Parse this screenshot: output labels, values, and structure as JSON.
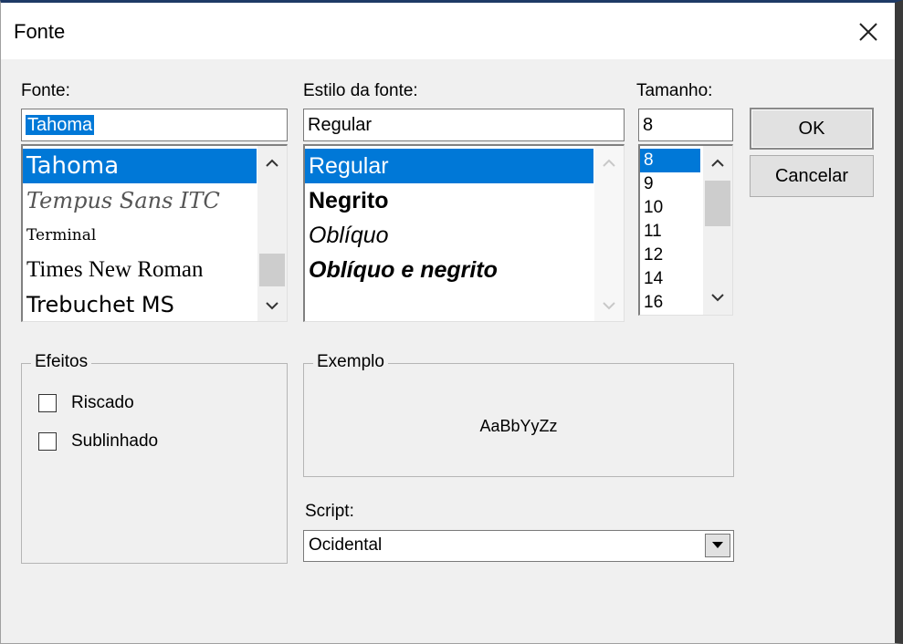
{
  "dialog": {
    "title": "Fonte",
    "close_icon": "close-icon"
  },
  "font": {
    "label": "Fonte:",
    "value": "Tahoma",
    "items": [
      "Tahoma",
      "Tempus Sans ITC",
      "Terminal",
      "Times New Roman",
      "Trebuchet MS"
    ],
    "selected": "Tahoma"
  },
  "style": {
    "label": "Estilo da fonte:",
    "value": "Regular",
    "items": [
      "Regular",
      "Negrito",
      "Oblíquo",
      "Oblíquo e negrito"
    ],
    "selected": "Regular"
  },
  "size": {
    "label": "Tamanho:",
    "value": "8",
    "items": [
      "8",
      "9",
      "10",
      "11",
      "12",
      "14",
      "16"
    ],
    "selected": "8"
  },
  "buttons": {
    "ok": "OK",
    "cancel": "Cancelar"
  },
  "effects": {
    "legend": "Efeitos",
    "strikeout": {
      "label": "Riscado",
      "checked": false
    },
    "underline": {
      "label": "Sublinhado",
      "checked": false
    }
  },
  "sample": {
    "legend": "Exemplo",
    "text": "AaBbYyZz"
  },
  "script": {
    "label": "Script:",
    "value": "Ocidental"
  },
  "colors": {
    "selection": "#0078d7",
    "background": "#f0f0f0"
  }
}
